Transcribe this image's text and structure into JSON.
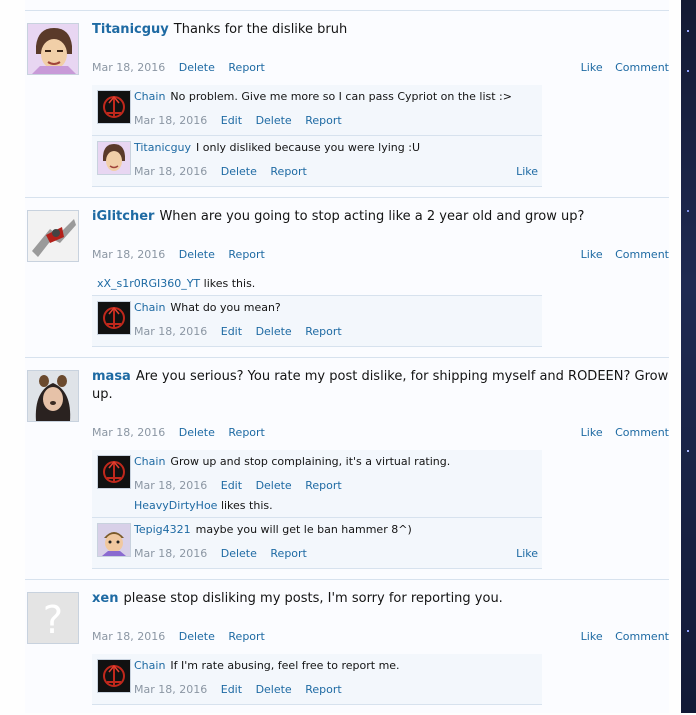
{
  "posts": [
    {
      "username": "Titanicguy",
      "message": "Thanks for the dislike bruh",
      "date": "Mar 18, 2016",
      "actions": [
        "Delete",
        "Report"
      ],
      "right_actions": [
        "Like",
        "Comment"
      ],
      "comments": [
        {
          "username": "Chain",
          "message": "No problem. Give me more so I can pass Cypriot on the list :>",
          "date": "Mar 18, 2016",
          "actions": [
            "Edit",
            "Delete",
            "Report"
          ]
        },
        {
          "username": "Titanicguy",
          "message": "I only disliked because you were lying :U",
          "date": "Mar 18, 2016",
          "actions": [
            "Delete",
            "Report"
          ],
          "right_action": "Like"
        }
      ]
    },
    {
      "username": "iGlitcher",
      "message": "When are you going to stop acting like a 2 year old and grow up?",
      "date": "Mar 18, 2016",
      "actions": [
        "Delete",
        "Report"
      ],
      "right_actions": [
        "Like",
        "Comment"
      ],
      "likes": {
        "liker": "xX_s1r0RGI360_YT",
        "suffix": " likes this."
      },
      "comments": [
        {
          "username": "Chain",
          "message": "What do you mean?",
          "date": "Mar 18, 2016",
          "actions": [
            "Edit",
            "Delete",
            "Report"
          ]
        }
      ]
    },
    {
      "username": "masa",
      "message": "Are you serious? You rate my post dislike, for shipping myself and RODEEN? Grow up.",
      "date": "Mar 18, 2016",
      "actions": [
        "Delete",
        "Report"
      ],
      "right_actions": [
        "Like",
        "Comment"
      ],
      "comments": [
        {
          "username": "Chain",
          "message": "Grow up and stop complaining, it's a virtual rating.",
          "date": "Mar 18, 2016",
          "actions": [
            "Edit",
            "Delete",
            "Report"
          ],
          "likes": {
            "liker": "HeavyDirtyHoe",
            "suffix": " likes this."
          }
        },
        {
          "username": "Tepig4321",
          "message": "maybe you will get le ban hammer 8^)",
          "date": "Mar 18, 2016",
          "actions": [
            "Delete",
            "Report"
          ],
          "right_action": "Like"
        }
      ]
    },
    {
      "username": "xen",
      "message": "please stop disliking my posts, I'm sorry for reporting you.",
      "date": "Mar 18, 2016",
      "actions": [
        "Delete",
        "Report"
      ],
      "right_actions": [
        "Like",
        "Comment"
      ],
      "comments": [
        {
          "username": "Chain",
          "message": "If I'm rate abusing, feel free to report me.",
          "date": "Mar 18, 2016",
          "actions": [
            "Edit",
            "Delete",
            "Report"
          ]
        }
      ]
    }
  ],
  "colors": {
    "link": "#1e6aa3",
    "date": "#8b96a3",
    "comment_bg": "#f3f7fc",
    "border": "#d7e2ee"
  }
}
